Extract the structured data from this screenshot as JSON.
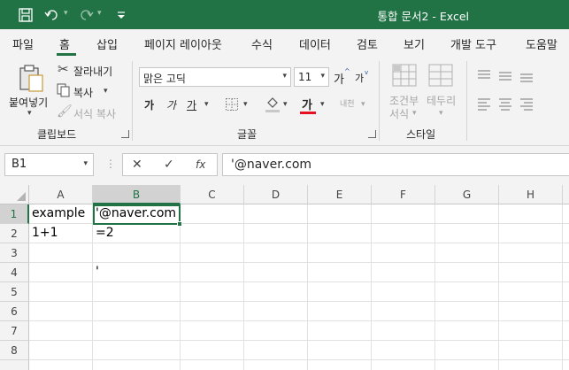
{
  "window": {
    "title": "통합 문서2  -  Excel"
  },
  "tabs": [
    {
      "label": "파일"
    },
    {
      "label": "홈"
    },
    {
      "label": "삽입"
    },
    {
      "label": "페이지 레이아웃"
    },
    {
      "label": "수식"
    },
    {
      "label": "데이터"
    },
    {
      "label": "검토"
    },
    {
      "label": "보기"
    },
    {
      "label": "개발 도구"
    },
    {
      "label": "도움말"
    }
  ],
  "ribbon": {
    "clipboard": {
      "paste": "붙여넣기",
      "cut": "잘라내기",
      "copy": "복사",
      "format_painter": "서식 복사",
      "label": "클립보드"
    },
    "font": {
      "name": "맑은 고딕",
      "size": "11",
      "grow": "가",
      "shrink": "가",
      "bold": "가",
      "italic": "가",
      "underline": "가",
      "color_glyph": "가",
      "phonetic": "내천",
      "label": "글꼴"
    },
    "styles": {
      "conditional_line1": "조건부",
      "conditional_line2": "서식",
      "table_line1": "테두리",
      "label": "스타일"
    }
  },
  "formula_bar": {
    "name_box": "B1",
    "content": "'@naver.com",
    "fx": "fx"
  },
  "grid": {
    "columns": [
      "A",
      "B",
      "C",
      "D",
      "E",
      "F",
      "G",
      "H"
    ],
    "rows": [
      "1",
      "2",
      "3",
      "4",
      "5",
      "6",
      "7",
      "8"
    ],
    "cells": {
      "A1": "example",
      "B1": "'@naver.com",
      "A2": "1+1",
      "B2": "=2",
      "B4": "'"
    }
  },
  "colors": {
    "accent": "#217346"
  }
}
